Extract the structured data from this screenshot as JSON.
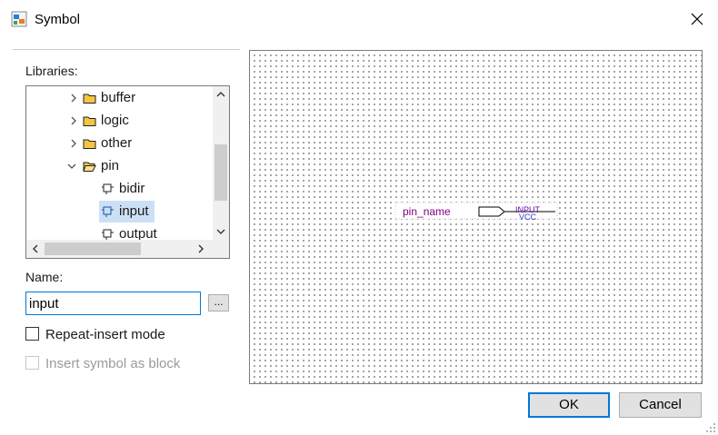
{
  "window": {
    "title": "Symbol",
    "close_icon": "close-icon"
  },
  "libraries": {
    "label": "Libraries:",
    "items": [
      {
        "label": "buffer",
        "type": "folder",
        "expanded": false
      },
      {
        "label": "logic",
        "type": "folder",
        "expanded": false
      },
      {
        "label": "other",
        "type": "folder",
        "expanded": false
      },
      {
        "label": "pin",
        "type": "folder",
        "expanded": true
      },
      {
        "label": "bidir",
        "type": "symbol"
      },
      {
        "label": "input",
        "type": "symbol",
        "selected": true
      },
      {
        "label": "output",
        "type": "symbol"
      }
    ]
  },
  "name": {
    "label": "Name:",
    "value": "input",
    "browse_label": "..."
  },
  "options": {
    "repeat_insert": {
      "label": "Repeat-insert mode",
      "checked": false,
      "enabled": true
    },
    "insert_block": {
      "label": "Insert symbol as block",
      "checked": false,
      "enabled": false
    }
  },
  "preview": {
    "pin_name": "pin_name",
    "type_label": "INPUT",
    "default_label": "VCC",
    "colors": {
      "pin_text": "#800080",
      "symbol_text": "#6a0dad",
      "default_text": "#3333cc"
    }
  },
  "buttons": {
    "ok": "OK",
    "cancel": "Cancel"
  },
  "colors": {
    "accent": "#0078d7",
    "selection": "#cce0f5",
    "folder": "#f5c542"
  }
}
